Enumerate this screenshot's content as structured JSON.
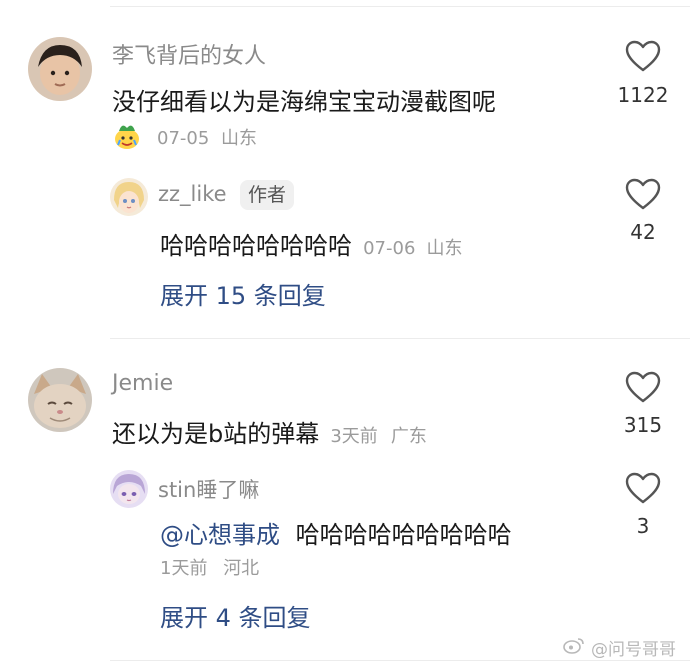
{
  "comments": [
    {
      "username": "李飞背后的女人",
      "text": "没仔细看以为是海绵宝宝动漫截图呢",
      "date": "07-05",
      "location": "山东",
      "likes": "1122",
      "reply": {
        "username": "zz_like",
        "badge": "作者",
        "text": "哈哈哈哈哈哈哈哈",
        "date": "07-06",
        "location": "山东",
        "likes": "42"
      },
      "expand_label": "展开 15 条回复"
    },
    {
      "username": "Jemie",
      "text": "还以为是b站的弹幕",
      "date": "3天前",
      "location": "广东",
      "likes": "315",
      "reply": {
        "username": "stin睡了嘛",
        "mention": "@心想事成",
        "text": "哈哈哈哈哈哈哈哈哈",
        "date": "1天前",
        "location": "河北",
        "likes": "3"
      },
      "expand_label": "展开 4 条回复"
    }
  ],
  "watermark": "@问号哥哥",
  "colors": {
    "link": "#2f4d85",
    "meta": "#9b9b9b",
    "username": "#8a8a8a"
  }
}
